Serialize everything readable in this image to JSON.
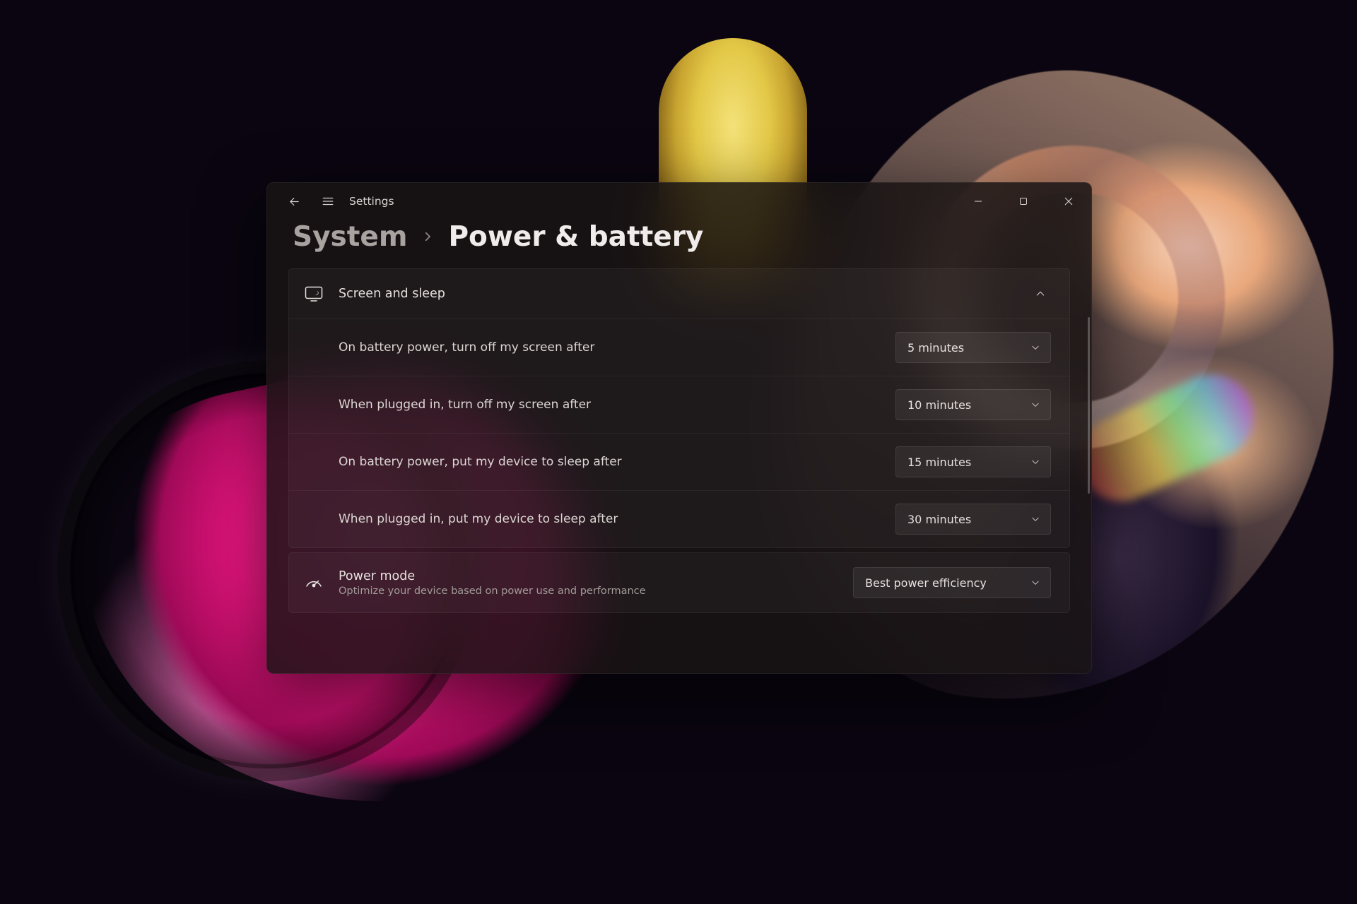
{
  "app": {
    "title": "Settings"
  },
  "breadcrumb": {
    "root": "System",
    "current": "Power & battery"
  },
  "screen_sleep": {
    "title": "Screen and sleep",
    "rows": [
      {
        "label": "On battery power, turn off my screen after",
        "value": "5 minutes"
      },
      {
        "label": "When plugged in, turn off my screen after",
        "value": "10 minutes"
      },
      {
        "label": "On battery power, put my device to sleep after",
        "value": "15 minutes"
      },
      {
        "label": "When plugged in, put my device to sleep after",
        "value": "30 minutes"
      }
    ]
  },
  "power_mode": {
    "title": "Power mode",
    "subtitle": "Optimize your device based on power use and performance",
    "value": "Best power efficiency"
  }
}
